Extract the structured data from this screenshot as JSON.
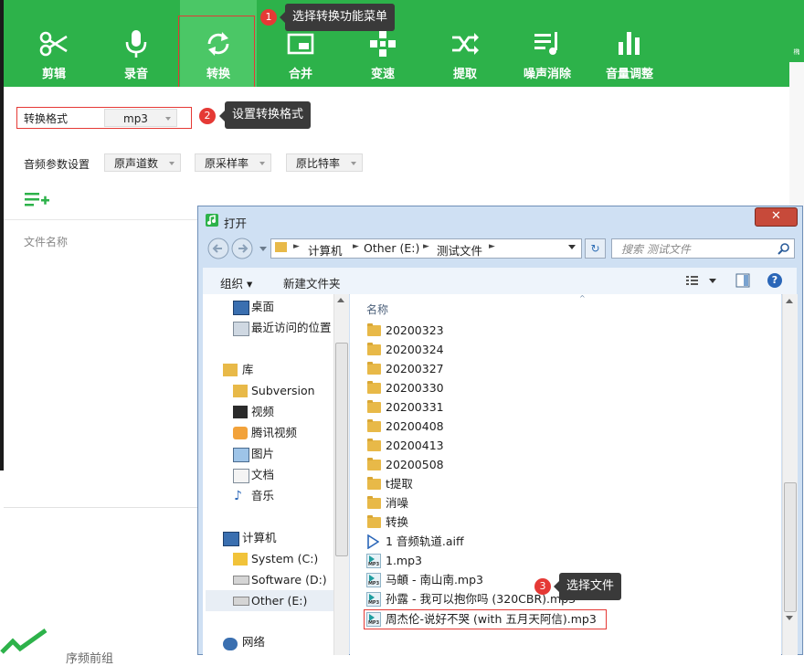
{
  "toolbar": {
    "items": [
      {
        "label": "剪辑",
        "icon": "scissors-icon"
      },
      {
        "label": "录音",
        "icon": "microphone-icon"
      },
      {
        "label": "转换",
        "icon": "convert-icon",
        "active": true
      },
      {
        "label": "合并",
        "icon": "merge-icon"
      },
      {
        "label": "变速",
        "icon": "speed-icon"
      },
      {
        "label": "提取",
        "icon": "extract-icon"
      },
      {
        "label": "噪声消除",
        "icon": "noise-reduction-icon"
      },
      {
        "label": "音量调整",
        "icon": "volume-adjust-icon"
      }
    ]
  },
  "callouts": [
    {
      "number": "1",
      "text": "选择转换功能菜单"
    },
    {
      "number": "2",
      "text": "设置转换格式"
    },
    {
      "number": "3",
      "text": "选择文件"
    }
  ],
  "convert": {
    "format_label": "转换格式",
    "format_value": "mp3",
    "params_label": "音频参数设置",
    "channels_value": "原声道数",
    "sample_rate_value": "原采样率",
    "bitrate_value": "原比特率",
    "file_name_header": "文件名称"
  },
  "right_strip_text": "椭",
  "bottom_left_text": "序频前组",
  "dialog": {
    "title": "打开",
    "close_glyph": "✕",
    "address": [
      "计算机",
      "Other (E:)",
      "测试文件"
    ],
    "search_placeholder": "搜索 测试文件",
    "organize_label": "组织 ▾",
    "new_folder_label": "新建文件夹",
    "column_name": "名称",
    "nav": {
      "desktop": "桌面",
      "recent": "最近访问的位置",
      "libraries": "库",
      "subversion": "Subversion",
      "videos": "视频",
      "tencent_video": "腾讯视频",
      "pictures": "图片",
      "documents": "文档",
      "music": "音乐",
      "computer": "计算机",
      "system_c": "System (C:)",
      "software_d": "Software (D:)",
      "other_e": "Other (E:)",
      "network": "网络"
    },
    "files": [
      {
        "name": "20200323",
        "type": "folder"
      },
      {
        "name": "20200324",
        "type": "folder"
      },
      {
        "name": "20200327",
        "type": "folder"
      },
      {
        "name": "20200330",
        "type": "folder"
      },
      {
        "name": "20200331",
        "type": "folder"
      },
      {
        "name": "20200408",
        "type": "folder"
      },
      {
        "name": "20200413",
        "type": "folder"
      },
      {
        "name": "20200508",
        "type": "folder"
      },
      {
        "name": "t提取",
        "type": "folder"
      },
      {
        "name": "消噪",
        "type": "folder"
      },
      {
        "name": "转换",
        "type": "folder"
      },
      {
        "name": "1 音频轨道.aiff",
        "type": "aiff"
      },
      {
        "name": "1.mp3",
        "type": "mp3"
      },
      {
        "name": "马頔 - 南山南.mp3",
        "type": "mp3"
      },
      {
        "name": "孙露 - 我可以抱你吗 (320CBR).mp3",
        "type": "mp3"
      },
      {
        "name": "周杰伦-说好不哭 (with 五月天阿信).mp3",
        "type": "mp3",
        "highlighted": true
      }
    ]
  },
  "colors": {
    "brand_green": "#2db24a",
    "active_green": "#4bc766",
    "callout_red": "#e53935",
    "tooltip_dark": "#3a3a3a",
    "dialog_frame": "#cfe0f3"
  }
}
